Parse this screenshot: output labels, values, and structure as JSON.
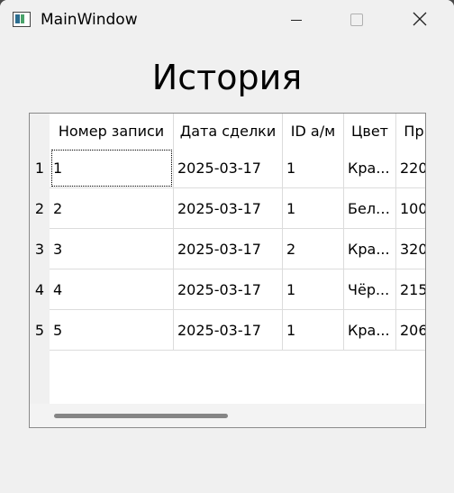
{
  "window": {
    "title": "MainWindow"
  },
  "heading": "История",
  "table": {
    "headers": [
      "Номер записи",
      "Дата сделки",
      "ID а/м",
      "Цвет",
      "Пр"
    ],
    "rows": [
      {
        "num": "1",
        "cells": [
          "1",
          "2025-03-17",
          "1",
          "Кра...",
          "220"
        ]
      },
      {
        "num": "2",
        "cells": [
          "2",
          "2025-03-17",
          "1",
          "Белый",
          "100"
        ]
      },
      {
        "num": "3",
        "cells": [
          "3",
          "2025-03-17",
          "2",
          "Кра...",
          "320"
        ]
      },
      {
        "num": "4",
        "cells": [
          "4",
          "2025-03-17",
          "1",
          "Чёр...",
          "215"
        ]
      },
      {
        "num": "5",
        "cells": [
          "5",
          "2025-03-17",
          "1",
          "Кра...",
          "206"
        ]
      }
    ]
  },
  "icons": {
    "app": "app-window-icon",
    "minimize": "minimize-icon",
    "maximize": "maximize-icon",
    "close": "close-icon"
  }
}
